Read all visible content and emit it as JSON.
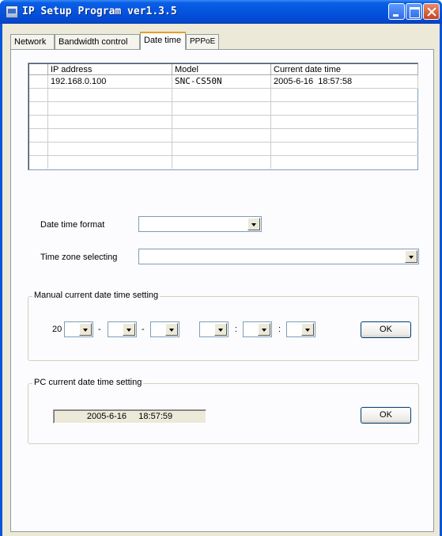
{
  "window": {
    "title": "IP Setup Program ver1.3.5"
  },
  "tabs": [
    {
      "label": "Network",
      "active": false
    },
    {
      "label": "Bandwidth control",
      "active": false
    },
    {
      "label": "Date time",
      "active": true
    },
    {
      "label": "PPPoE",
      "active": false
    }
  ],
  "device_list": {
    "columns": [
      "IP address",
      "Model",
      "Current date time"
    ],
    "rows": [
      [
        "192.168.0.100",
        "SNC-CS50N",
        "2005-6-16  18:57:58"
      ],
      [
        "",
        "",
        ""
      ],
      [
        "",
        "",
        ""
      ],
      [
        "",
        "",
        ""
      ],
      [
        "",
        "",
        ""
      ],
      [
        "",
        "",
        ""
      ],
      [
        "",
        "",
        ""
      ]
    ]
  },
  "date_time_format": {
    "label": "Date time format",
    "value": ""
  },
  "time_zone": {
    "label": "Time zone selecting",
    "value": ""
  },
  "manual_setting": {
    "legend": "Manual current date time setting",
    "year_prefix": "20",
    "date_separator": "-",
    "time_separator": ":",
    "ok_label": "OK"
  },
  "pc_setting": {
    "legend": "PC current date time setting",
    "current_value": "2005-6-16     18:57:59",
    "ok_label": "OK"
  },
  "colors": {
    "title_bar": "#0454de",
    "dialog_bg": "#ece9d8",
    "active_tab_accent": "#e6a02a"
  }
}
